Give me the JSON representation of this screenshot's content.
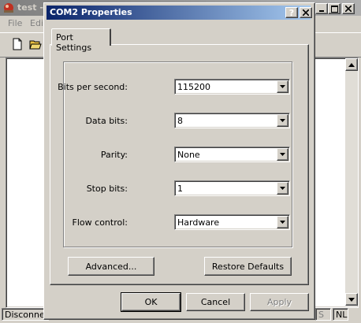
{
  "bg_window": {
    "title": "test -",
    "menu": [
      "File",
      "Edi"
    ],
    "status": [
      "Disconnec",
      "S",
      "NL"
    ]
  },
  "dialog": {
    "title": "COM2 Properties",
    "title_buttons": {
      "help": "?",
      "close": "✕"
    },
    "tab": "Port Settings",
    "fields": [
      {
        "label": "Bits per second:",
        "value": "115200"
      },
      {
        "label": "Data bits:",
        "value": "8"
      },
      {
        "label": "Parity:",
        "value": "None"
      },
      {
        "label": "Stop bits:",
        "value": "1"
      },
      {
        "label": "Flow control:",
        "value": "Hardware"
      }
    ],
    "advanced_button": "Advanced...",
    "restore_button": "Restore Defaults",
    "ok_button": "OK",
    "cancel_button": "Cancel",
    "apply_button": "Apply"
  },
  "colors": {
    "titlebar_active": "#0a246a",
    "titlebar_inactive": "#808080",
    "face": "#d4d0c8"
  }
}
